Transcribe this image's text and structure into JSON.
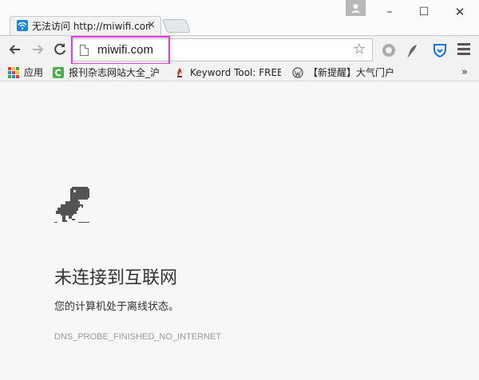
{
  "tab": {
    "title": "无法访问 http://miwifi.com",
    "close_glyph": "×",
    "favicon": "wifi-icon"
  },
  "window_controls": {
    "minimize": "–",
    "maximize": "☐",
    "close": "✕"
  },
  "toolbar": {
    "url": "miwifi.com",
    "highlight_color": "#e43be6"
  },
  "bookmarks": [
    {
      "label": "应用",
      "icon": "apps-grid-icon"
    },
    {
      "label": "报刊杂志网站大全_沪",
      "icon": "green-c-icon"
    },
    {
      "label": "Keyword Tool: FREE",
      "icon": "flame-icon"
    },
    {
      "label": "【新提醒】大气门户",
      "icon": "wordpress-icon"
    }
  ],
  "bookmarks_more": "»",
  "error_page": {
    "title": "未连接到互联网",
    "message": "您的计算机处于离线状态。",
    "code": "DNS_PROBE_FINISHED_NO_INTERNET"
  },
  "colors": {
    "tab_favicon": "#1c86e6",
    "shield_extension": "#1a73e8",
    "dino": "#535353"
  }
}
